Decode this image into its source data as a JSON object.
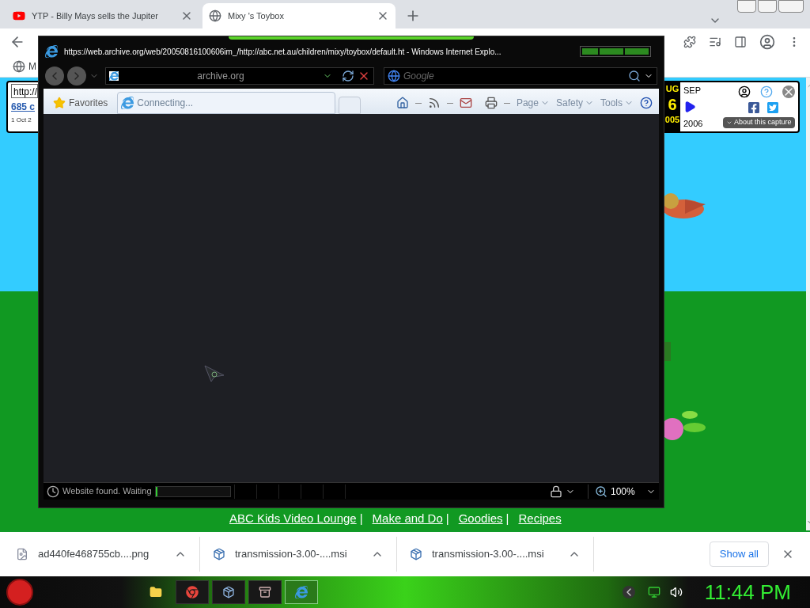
{
  "browser_tabs": [
    {
      "title": "YTP - Billy Mays sells the Jupiter",
      "kind": "video",
      "selected": false
    },
    {
      "title": "Mixy 's Toybox",
      "kind": "web",
      "selected": true
    }
  ],
  "bookmarks_bar": {
    "items": [
      "M"
    ]
  },
  "wayback": {
    "url_field": "http://",
    "captures_link": "685 c",
    "date_range": "1 Oct 2",
    "prev_month": "UG",
    "day": "6",
    "prev_year": "005",
    "next_month": "SEP",
    "next_year": "2006",
    "about_button": "About this capture"
  },
  "page_links": [
    "ABC Kids Video Lounge",
    "Make and Do",
    "Goodies",
    "Recipes"
  ],
  "link_separator": "|",
  "ie_window": {
    "title": "https://web.archive.org/web/20050816100606im_/http://abc.net.au/children/mixy/toybox/default.ht - Windows Internet Explo...",
    "address": "archive.org",
    "search_placeholder": "Google",
    "favorites": "Favorites",
    "tabs": [
      {
        "title": "Connecting...",
        "selected": true
      }
    ],
    "command_menus": [
      "Page",
      "Safety",
      "Tools"
    ],
    "status": "Website found. Waiting",
    "progress": {
      "level": 0.01
    },
    "zoom": "100%"
  },
  "downloads": {
    "items": [
      {
        "name": "ad440fe468755cb....png",
        "kind": "image"
      },
      {
        "name": "transmission-3.00-....msi",
        "kind": "installer"
      },
      {
        "name": "transmission-3.00-....msi",
        "kind": "installer"
      }
    ],
    "show_all": "Show all"
  },
  "taskbar": {
    "apps": [
      {
        "kind": "folder",
        "selected": false
      },
      {
        "kind": "chrome",
        "selected": false
      },
      {
        "kind": "installer",
        "selected": false
      },
      {
        "kind": "archive",
        "selected": false
      },
      {
        "kind": "ie",
        "selected": true
      }
    ],
    "clock": "11:44 PM"
  }
}
